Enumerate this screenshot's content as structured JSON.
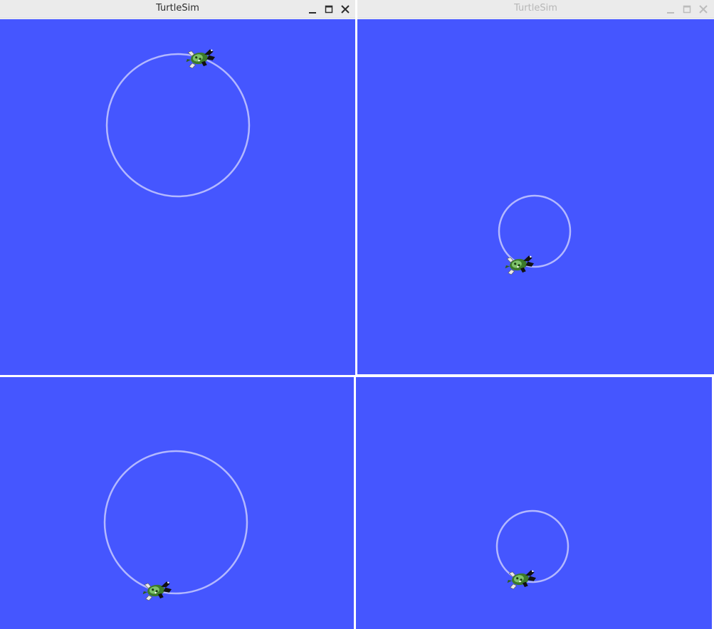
{
  "windows": [
    {
      "id": "top-left",
      "title": "TurtleSim",
      "focused": true,
      "controls": [
        "minimize-icon",
        "maximize-icon",
        "close-icon"
      ],
      "background_color": "#4556ff",
      "pen_color": "#b3b8ff",
      "turtle": "turtle-icon"
    },
    {
      "id": "top-right",
      "title": "TurtleSim",
      "focused": false,
      "controls": [
        "minimize-icon",
        "maximize-icon",
        "close-icon"
      ],
      "background_color": "#4556ff",
      "pen_color": "#b3b8ff",
      "turtle": "turtle-icon"
    },
    {
      "id": "bottom-left",
      "background_color": "#4556ff",
      "pen_color": "#b3b8ff",
      "turtle": "turtle-icon"
    },
    {
      "id": "bottom-right",
      "background_color": "#4556ff",
      "pen_color": "#b3b8ff",
      "turtle": "turtle-icon"
    }
  ]
}
